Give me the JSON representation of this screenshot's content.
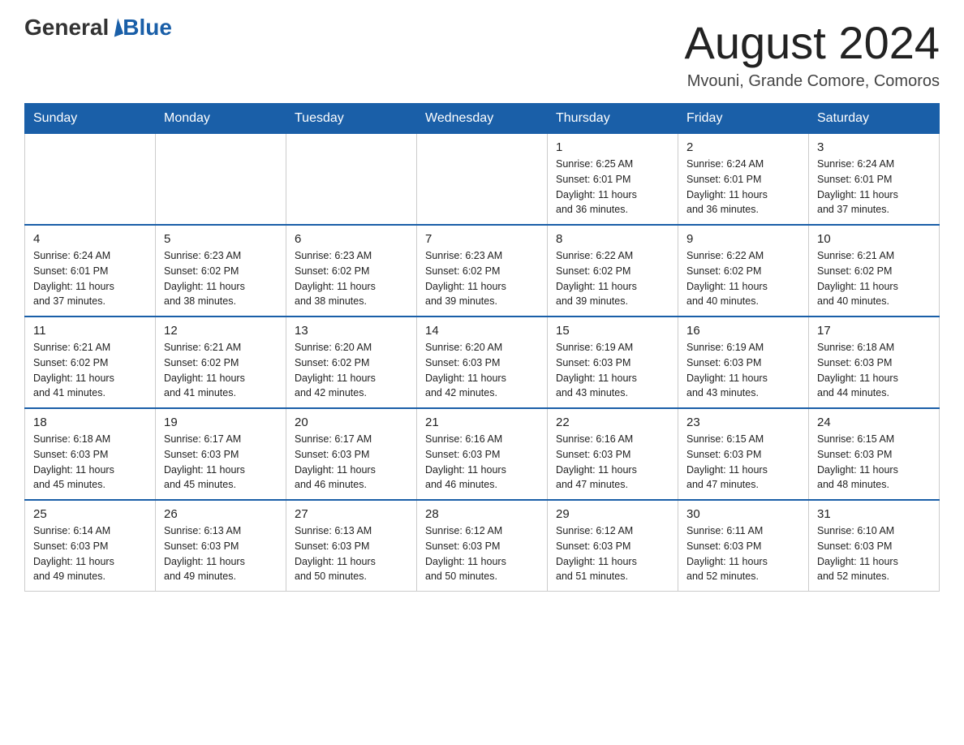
{
  "logo": {
    "general": "General",
    "blue": "Blue"
  },
  "title": "August 2024",
  "subtitle": "Mvouni, Grande Comore, Comoros",
  "days_of_week": [
    "Sunday",
    "Monday",
    "Tuesday",
    "Wednesday",
    "Thursday",
    "Friday",
    "Saturday"
  ],
  "weeks": [
    [
      {
        "day": "",
        "info": ""
      },
      {
        "day": "",
        "info": ""
      },
      {
        "day": "",
        "info": ""
      },
      {
        "day": "",
        "info": ""
      },
      {
        "day": "1",
        "info": "Sunrise: 6:25 AM\nSunset: 6:01 PM\nDaylight: 11 hours\nand 36 minutes."
      },
      {
        "day": "2",
        "info": "Sunrise: 6:24 AM\nSunset: 6:01 PM\nDaylight: 11 hours\nand 36 minutes."
      },
      {
        "day": "3",
        "info": "Sunrise: 6:24 AM\nSunset: 6:01 PM\nDaylight: 11 hours\nand 37 minutes."
      }
    ],
    [
      {
        "day": "4",
        "info": "Sunrise: 6:24 AM\nSunset: 6:01 PM\nDaylight: 11 hours\nand 37 minutes."
      },
      {
        "day": "5",
        "info": "Sunrise: 6:23 AM\nSunset: 6:02 PM\nDaylight: 11 hours\nand 38 minutes."
      },
      {
        "day": "6",
        "info": "Sunrise: 6:23 AM\nSunset: 6:02 PM\nDaylight: 11 hours\nand 38 minutes."
      },
      {
        "day": "7",
        "info": "Sunrise: 6:23 AM\nSunset: 6:02 PM\nDaylight: 11 hours\nand 39 minutes."
      },
      {
        "day": "8",
        "info": "Sunrise: 6:22 AM\nSunset: 6:02 PM\nDaylight: 11 hours\nand 39 minutes."
      },
      {
        "day": "9",
        "info": "Sunrise: 6:22 AM\nSunset: 6:02 PM\nDaylight: 11 hours\nand 40 minutes."
      },
      {
        "day": "10",
        "info": "Sunrise: 6:21 AM\nSunset: 6:02 PM\nDaylight: 11 hours\nand 40 minutes."
      }
    ],
    [
      {
        "day": "11",
        "info": "Sunrise: 6:21 AM\nSunset: 6:02 PM\nDaylight: 11 hours\nand 41 minutes."
      },
      {
        "day": "12",
        "info": "Sunrise: 6:21 AM\nSunset: 6:02 PM\nDaylight: 11 hours\nand 41 minutes."
      },
      {
        "day": "13",
        "info": "Sunrise: 6:20 AM\nSunset: 6:02 PM\nDaylight: 11 hours\nand 42 minutes."
      },
      {
        "day": "14",
        "info": "Sunrise: 6:20 AM\nSunset: 6:03 PM\nDaylight: 11 hours\nand 42 minutes."
      },
      {
        "day": "15",
        "info": "Sunrise: 6:19 AM\nSunset: 6:03 PM\nDaylight: 11 hours\nand 43 minutes."
      },
      {
        "day": "16",
        "info": "Sunrise: 6:19 AM\nSunset: 6:03 PM\nDaylight: 11 hours\nand 43 minutes."
      },
      {
        "day": "17",
        "info": "Sunrise: 6:18 AM\nSunset: 6:03 PM\nDaylight: 11 hours\nand 44 minutes."
      }
    ],
    [
      {
        "day": "18",
        "info": "Sunrise: 6:18 AM\nSunset: 6:03 PM\nDaylight: 11 hours\nand 45 minutes."
      },
      {
        "day": "19",
        "info": "Sunrise: 6:17 AM\nSunset: 6:03 PM\nDaylight: 11 hours\nand 45 minutes."
      },
      {
        "day": "20",
        "info": "Sunrise: 6:17 AM\nSunset: 6:03 PM\nDaylight: 11 hours\nand 46 minutes."
      },
      {
        "day": "21",
        "info": "Sunrise: 6:16 AM\nSunset: 6:03 PM\nDaylight: 11 hours\nand 46 minutes."
      },
      {
        "day": "22",
        "info": "Sunrise: 6:16 AM\nSunset: 6:03 PM\nDaylight: 11 hours\nand 47 minutes."
      },
      {
        "day": "23",
        "info": "Sunrise: 6:15 AM\nSunset: 6:03 PM\nDaylight: 11 hours\nand 47 minutes."
      },
      {
        "day": "24",
        "info": "Sunrise: 6:15 AM\nSunset: 6:03 PM\nDaylight: 11 hours\nand 48 minutes."
      }
    ],
    [
      {
        "day": "25",
        "info": "Sunrise: 6:14 AM\nSunset: 6:03 PM\nDaylight: 11 hours\nand 49 minutes."
      },
      {
        "day": "26",
        "info": "Sunrise: 6:13 AM\nSunset: 6:03 PM\nDaylight: 11 hours\nand 49 minutes."
      },
      {
        "day": "27",
        "info": "Sunrise: 6:13 AM\nSunset: 6:03 PM\nDaylight: 11 hours\nand 50 minutes."
      },
      {
        "day": "28",
        "info": "Sunrise: 6:12 AM\nSunset: 6:03 PM\nDaylight: 11 hours\nand 50 minutes."
      },
      {
        "day": "29",
        "info": "Sunrise: 6:12 AM\nSunset: 6:03 PM\nDaylight: 11 hours\nand 51 minutes."
      },
      {
        "day": "30",
        "info": "Sunrise: 6:11 AM\nSunset: 6:03 PM\nDaylight: 11 hours\nand 52 minutes."
      },
      {
        "day": "31",
        "info": "Sunrise: 6:10 AM\nSunset: 6:03 PM\nDaylight: 11 hours\nand 52 minutes."
      }
    ]
  ]
}
